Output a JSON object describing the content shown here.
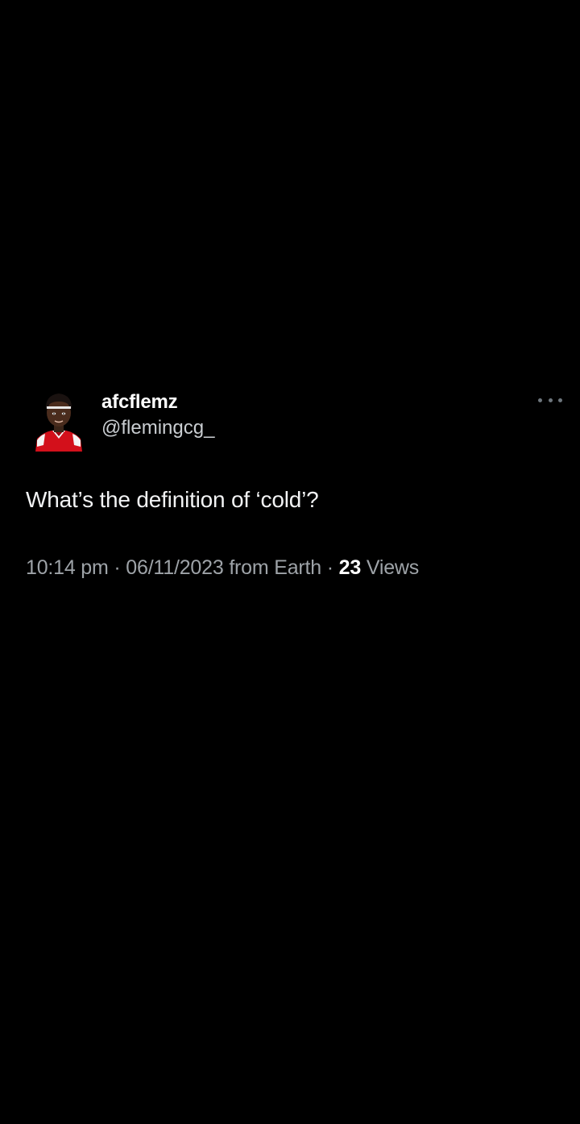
{
  "tweet": {
    "display_name": "afcflemz",
    "handle": "@flemingcg_",
    "text": "What’s the definition of ‘cold’?",
    "time": "10:14 pm",
    "separator": "·",
    "date": "06/11/2023",
    "source": "from Earth",
    "views_count": "23",
    "views_label": "Views",
    "avatar_icon": "avatar-photo",
    "more_icon": "more-options-icon",
    "colors": {
      "background": "#000000",
      "text": "#e7e9ea",
      "secondary": "#9ea3a8",
      "jersey": "#d3101b"
    }
  }
}
